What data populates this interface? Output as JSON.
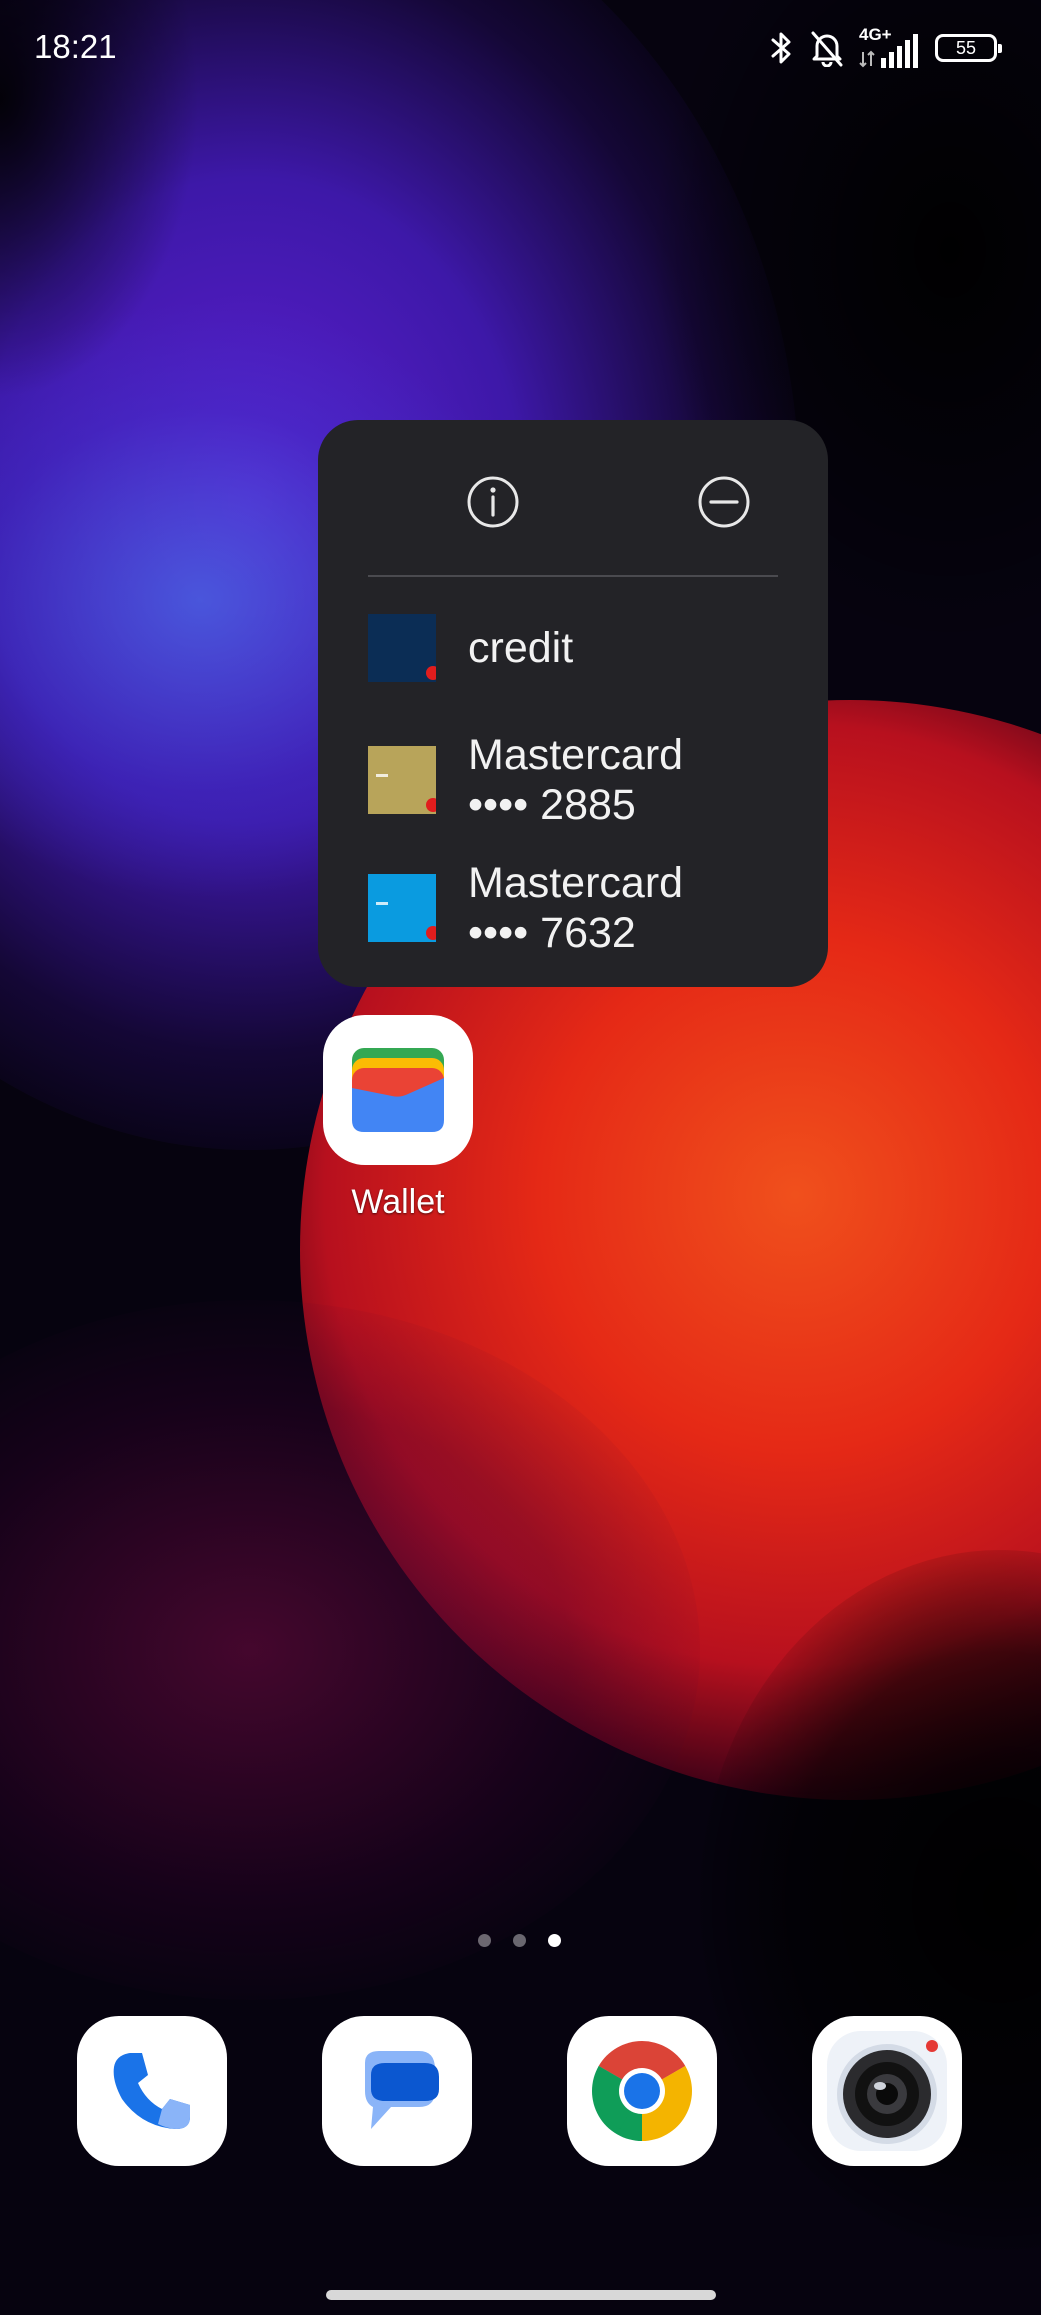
{
  "status_bar": {
    "time": "18:21",
    "network": "4G+",
    "battery": "55"
  },
  "popup": {
    "info_icon": "info-icon",
    "remove_icon": "remove-icon",
    "shortcuts": [
      {
        "label": "credit",
        "color": "#0b2d55"
      },
      {
        "label": "Mastercard\n•••• 2885",
        "color": "#b8a45a"
      },
      {
        "label": "Mastercard\n•••• 7632",
        "color": "#0a9be0"
      }
    ]
  },
  "wallet_app": {
    "label": "Wallet"
  },
  "page_indicator": {
    "pages": 3,
    "active": 3
  },
  "dock": {
    "apps": [
      "phone-icon",
      "messages-icon",
      "chrome-icon",
      "camera-icon"
    ]
  }
}
